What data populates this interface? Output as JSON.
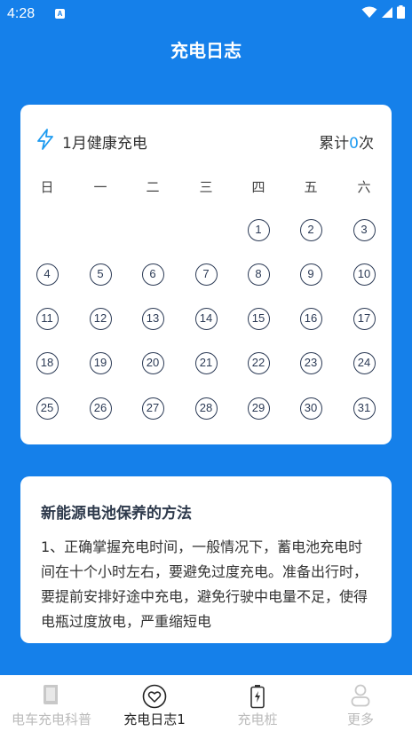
{
  "status_bar": {
    "time": "4:28",
    "app_icon_letter": "A"
  },
  "page": {
    "title": "充电日志"
  },
  "calendar": {
    "month_title": "1月健康充电",
    "count_prefix": "累计",
    "count_value": "0",
    "count_suffix": "次",
    "weekdays": [
      "日",
      "一",
      "二",
      "三",
      "四",
      "五",
      "六"
    ],
    "first_weekday_index": 4,
    "days": [
      "1",
      "2",
      "3",
      "4",
      "5",
      "6",
      "7",
      "8",
      "9",
      "10",
      "11",
      "12",
      "13",
      "14",
      "15",
      "16",
      "17",
      "18",
      "19",
      "20",
      "21",
      "22",
      "23",
      "24",
      "25",
      "26",
      "27",
      "28",
      "29",
      "30",
      "31"
    ]
  },
  "article": {
    "title": "新能源电池保养的方法",
    "body": "1、正确掌握充电时间，一般情况下，蓄电池充电时间在十个小时左右，要避免过度充电。准备出行时，要提前安排好途中充电，避免行驶中电量不足，使得电瓶过度放电，严重缩短电"
  },
  "tabs": [
    {
      "label": "电车充电科普",
      "icon": "book-icon",
      "active": false
    },
    {
      "label": "充电日志1",
      "icon": "heart-icon",
      "active": true
    },
    {
      "label": "充电桩",
      "icon": "battery-bolt-icon",
      "active": false
    },
    {
      "label": "更多",
      "icon": "person-icon",
      "active": false
    }
  ],
  "colors": {
    "primary": "#1580EA",
    "accent": "#1E9BF0",
    "day_ring": "#2B3A55"
  }
}
